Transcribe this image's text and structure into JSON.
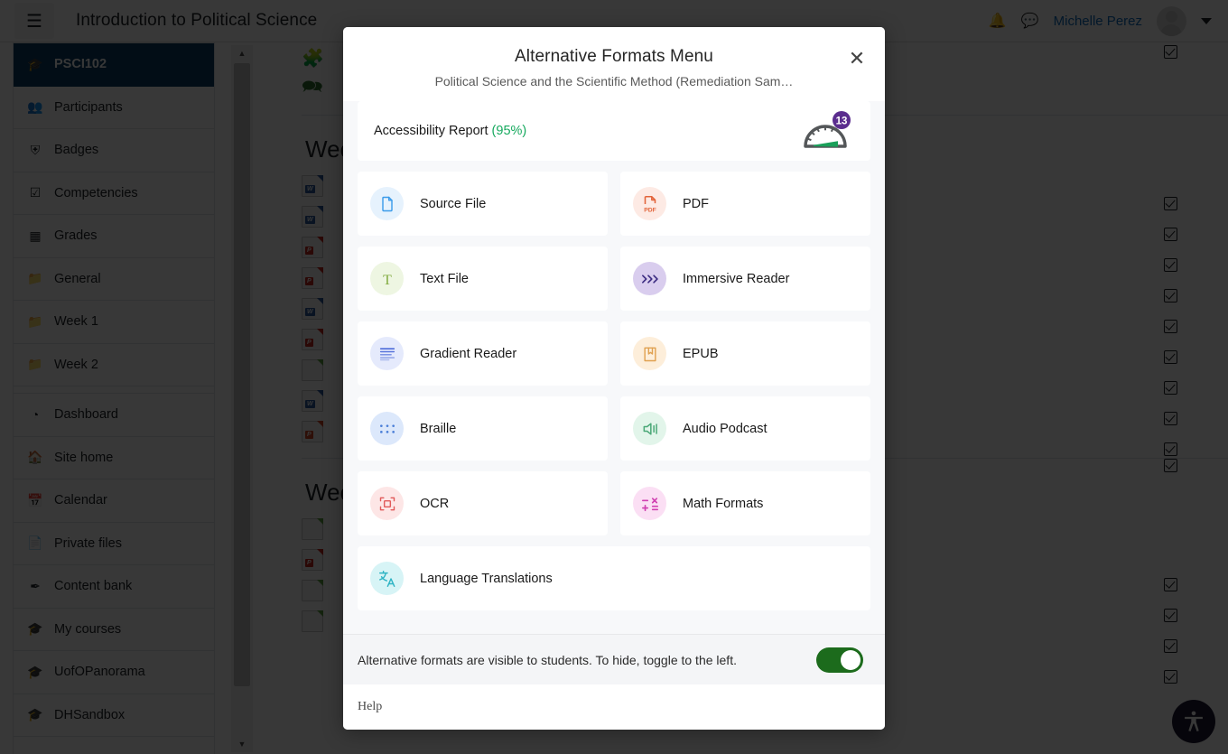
{
  "navbar": {
    "menu_icon": "hamburger-icon",
    "title": "Introduction to Political Science",
    "notifications_icon": "bell-icon",
    "messages_icon": "chat-bubble-icon",
    "user_name": "Michelle Perez",
    "caret_icon": "chevron-down-icon"
  },
  "sidebar": {
    "items": [
      {
        "label": "PSCI102",
        "icon": "graduation-cap-icon",
        "active": true
      },
      {
        "label": "Participants",
        "icon": "users-icon",
        "active": false
      },
      {
        "label": "Badges",
        "icon": "shield-icon",
        "active": false
      },
      {
        "label": "Competencies",
        "icon": "check-square-icon",
        "active": false
      },
      {
        "label": "Grades",
        "icon": "table-icon",
        "active": false
      },
      {
        "label": "General",
        "icon": "folder-icon",
        "active": false
      },
      {
        "label": "Week 1",
        "icon": "folder-icon",
        "active": false
      },
      {
        "label": "Week 2",
        "icon": "folder-icon",
        "active": false
      },
      {
        "label": "Dashboard",
        "icon": "speedometer-icon",
        "active": false
      },
      {
        "label": "Site home",
        "icon": "home-icon",
        "active": false
      },
      {
        "label": "Calendar",
        "icon": "calendar-icon",
        "active": false
      },
      {
        "label": "Private files",
        "icon": "file-icon",
        "active": false
      },
      {
        "label": "Content bank",
        "icon": "brush-icon",
        "active": false
      },
      {
        "label": "My courses",
        "icon": "graduation-cap-icon",
        "active": false
      },
      {
        "label": "UofOPanorama",
        "icon": "graduation-cap-icon",
        "active": false
      },
      {
        "label": "DHSandbox",
        "icon": "graduation-cap-icon",
        "active": false
      }
    ]
  },
  "background_content": {
    "section_headings": [
      "Week",
      "Week"
    ],
    "resource_icon_types": [
      "puzzle-icon",
      "forum-icon",
      "word-icon",
      "word-icon",
      "pdf-icon",
      "pdf-icon",
      "word-icon",
      "pdf-icon",
      "generic-icon",
      "word-icon",
      "powerpoint-icon",
      "generic-icon",
      "pdf-icon",
      "generic-icon",
      "generic-icon"
    ]
  },
  "a11y_fab": {
    "icon": "accessibility-icon"
  },
  "modal": {
    "title": "Alternative Formats Menu",
    "subtitle": "Political Science and the Scientific Method (Remediation Sam…",
    "close_icon": "close-icon",
    "report": {
      "label": "Accessibility Report",
      "percent": "(95%)",
      "percent_color": "#16a95e",
      "gauge_icon": "gauge-icon",
      "badge_count": "13",
      "badge_color": "#5b2d8e",
      "needle_color": "#1aa05a"
    },
    "formats": [
      {
        "label": "Source File",
        "icon": "file-outline-icon",
        "bg": "#e6f2fd",
        "fg": "#3a9bea"
      },
      {
        "label": "PDF",
        "icon": "pdf-file-icon",
        "bg": "#fdeae4",
        "fg": "#e2643a"
      },
      {
        "label": "Text File",
        "icon": "serif-t-icon",
        "bg": "#eef6e2",
        "fg": "#7fa93c"
      },
      {
        "label": "Immersive Reader",
        "icon": "chevrons-right-icon",
        "bg": "#d9cdee",
        "fg": "#3d2d82"
      },
      {
        "label": "Gradient Reader",
        "icon": "text-lines-icon",
        "bg": "#e5eafc",
        "fg": "#4161d6"
      },
      {
        "label": "EPUB",
        "icon": "book-bookmark-icon",
        "bg": "#fdeeda",
        "fg": "#e0a150"
      },
      {
        "label": "Braille",
        "icon": "braille-dots-icon",
        "bg": "#dce8fb",
        "fg": "#4b7fd8"
      },
      {
        "label": "Audio Podcast",
        "icon": "speaker-icon",
        "bg": "#e2f5ea",
        "fg": "#4aa877"
      },
      {
        "label": "OCR",
        "icon": "scan-frame-icon",
        "bg": "#fde6e6",
        "fg": "#e15a5a"
      },
      {
        "label": "Math Formats",
        "icon": "math-symbols-icon",
        "bg": "#fbdff4",
        "fg": "#d03fb0"
      },
      {
        "label": "Language Translations",
        "icon": "translate-icon",
        "bg": "#d7f4f6",
        "fg": "#2fb4c4",
        "full": true
      }
    ],
    "footer": {
      "text": "Alternative formats are visible to students. To hide, toggle to the left.",
      "toggle_on": true,
      "toggle_color": "#1c6b1c"
    },
    "help_label": "Help"
  }
}
